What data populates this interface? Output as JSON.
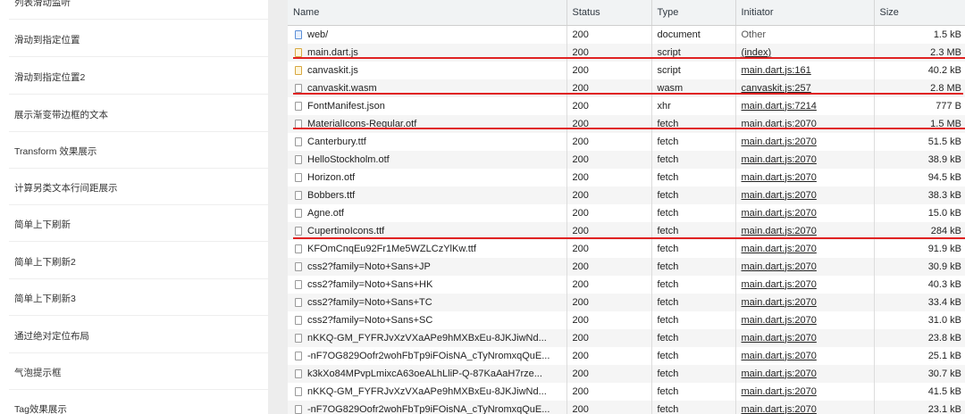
{
  "left_list": {
    "items": [
      "列表滑动监听",
      "滑动到指定位置",
      "滑动到指定位置2",
      "展示渐变带边框的文本",
      "Transform 效果展示",
      "计算另类文本行间距展示",
      "简单上下刷新",
      "简单上下刷新2",
      "简单上下刷新3",
      "通过绝对定位布局",
      "气泡提示框",
      "Tag效果展示"
    ]
  },
  "network": {
    "headers": {
      "name": "Name",
      "status": "Status",
      "type": "Type",
      "initiator": "Initiator",
      "size": "Size"
    },
    "rows": [
      {
        "name": "web/",
        "status": "200",
        "type": "document",
        "initiator": "Other",
        "size": "1.5 kB",
        "icon": "document-icon"
      },
      {
        "name": "main.dart.js",
        "status": "200",
        "type": "script",
        "initiator": "(index)",
        "size": "2.3 MB",
        "icon": "script-icon"
      },
      {
        "name": "canvaskit.js",
        "status": "200",
        "type": "script",
        "initiator": "main.dart.js:161",
        "size": "40.2 kB",
        "icon": "script-icon"
      },
      {
        "name": "canvaskit.wasm",
        "status": "200",
        "type": "wasm",
        "initiator": "canvaskit.js:257",
        "size": "2.8 MB",
        "icon": "file-icon"
      },
      {
        "name": "FontManifest.json",
        "status": "200",
        "type": "xhr",
        "initiator": "main.dart.js:7214",
        "size": "777 B",
        "icon": "file-icon"
      },
      {
        "name": "MaterialIcons-Regular.otf",
        "status": "200",
        "type": "fetch",
        "initiator": "main.dart.js:2070",
        "size": "1.5 MB",
        "icon": "file-icon"
      },
      {
        "name": "Canterbury.ttf",
        "status": "200",
        "type": "fetch",
        "initiator": "main.dart.js:2070",
        "size": "51.5 kB",
        "icon": "file-icon"
      },
      {
        "name": "HelloStockholm.otf",
        "status": "200",
        "type": "fetch",
        "initiator": "main.dart.js:2070",
        "size": "38.9 kB",
        "icon": "file-icon"
      },
      {
        "name": "Horizon.otf",
        "status": "200",
        "type": "fetch",
        "initiator": "main.dart.js:2070",
        "size": "94.5 kB",
        "icon": "file-icon"
      },
      {
        "name": "Bobbers.ttf",
        "status": "200",
        "type": "fetch",
        "initiator": "main.dart.js:2070",
        "size": "38.3 kB",
        "icon": "file-icon"
      },
      {
        "name": "Agne.otf",
        "status": "200",
        "type": "fetch",
        "initiator": "main.dart.js:2070",
        "size": "15.0 kB",
        "icon": "file-icon"
      },
      {
        "name": "CupertinoIcons.ttf",
        "status": "200",
        "type": "fetch",
        "initiator": "main.dart.js:2070",
        "size": "284 kB",
        "icon": "file-icon"
      },
      {
        "name": "KFOmCnqEu92Fr1Me5WZLCzYlKw.ttf",
        "status": "200",
        "type": "fetch",
        "initiator": "main.dart.js:2070",
        "size": "91.9 kB",
        "icon": "file-icon"
      },
      {
        "name": "css2?family=Noto+Sans+JP",
        "status": "200",
        "type": "fetch",
        "initiator": "main.dart.js:2070",
        "size": "30.9 kB",
        "icon": "file-icon"
      },
      {
        "name": "css2?family=Noto+Sans+HK",
        "status": "200",
        "type": "fetch",
        "initiator": "main.dart.js:2070",
        "size": "40.3 kB",
        "icon": "file-icon"
      },
      {
        "name": "css2?family=Noto+Sans+TC",
        "status": "200",
        "type": "fetch",
        "initiator": "main.dart.js:2070",
        "size": "33.4 kB",
        "icon": "file-icon"
      },
      {
        "name": "css2?family=Noto+Sans+SC",
        "status": "200",
        "type": "fetch",
        "initiator": "main.dart.js:2070",
        "size": "31.0 kB",
        "icon": "file-icon"
      },
      {
        "name": "nKKQ-GM_FYFRJvXzVXaAPe9hMXBxEu-8JKJiwNd...",
        "status": "200",
        "type": "fetch",
        "initiator": "main.dart.js:2070",
        "size": "23.8 kB",
        "icon": "file-icon"
      },
      {
        "name": "-nF7OG829Oofr2wohFbTp9iFOisNA_cTyNromxqQuE...",
        "status": "200",
        "type": "fetch",
        "initiator": "main.dart.js:2070",
        "size": "25.1 kB",
        "icon": "file-icon"
      },
      {
        "name": "k3kXo84MPvpLmixcA63oeALhLliP-Q-87KaAaH7rze...",
        "status": "200",
        "type": "fetch",
        "initiator": "main.dart.js:2070",
        "size": "30.7 kB",
        "icon": "file-icon"
      },
      {
        "name": "nKKQ-GM_FYFRJvXzVXaAPe9hMXBxEu-8JKJiwNd...",
        "status": "200",
        "type": "fetch",
        "initiator": "main.dart.js:2070",
        "size": "41.5 kB",
        "icon": "file-icon"
      },
      {
        "name": "-nF7OG829Oofr2wohFbTp9iFOisNA_cTyNromxqQuE...",
        "status": "200",
        "type": "fetch",
        "initiator": "main.dart.js:2070",
        "size": "23.1 kB",
        "icon": "file-icon"
      }
    ]
  },
  "colors": {
    "annotation_red": "#e02222"
  }
}
